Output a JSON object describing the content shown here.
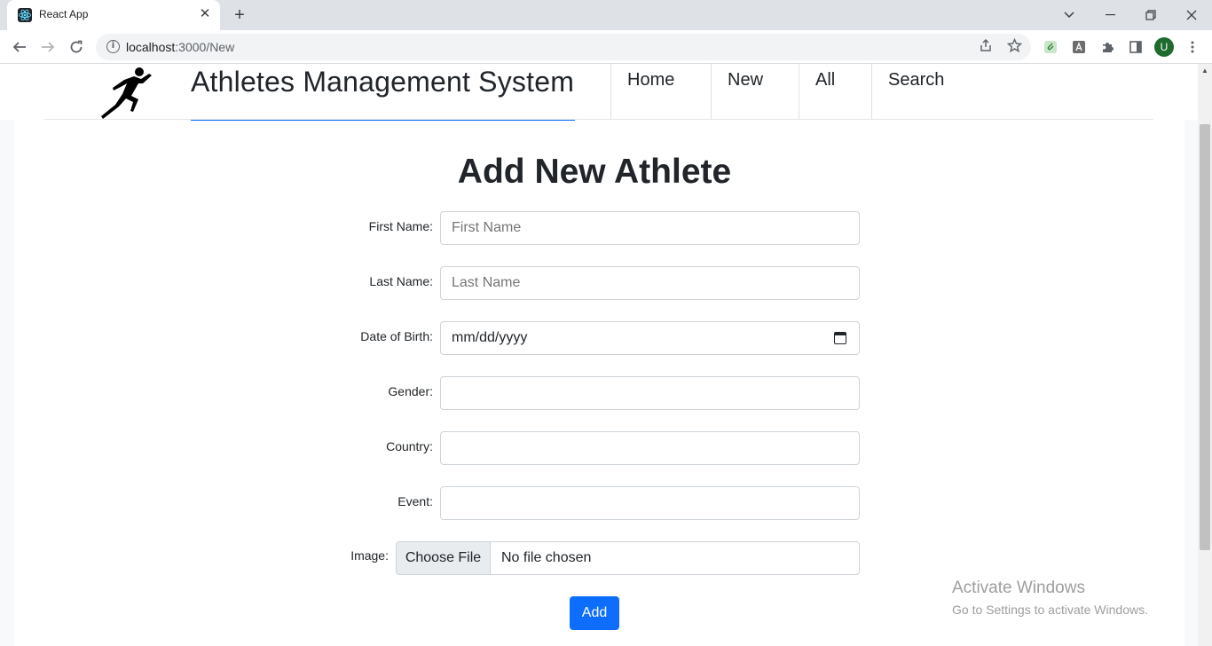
{
  "browser": {
    "tab_title": "React App",
    "tab_close": "✕",
    "new_tab": "+",
    "url_host": "localhost",
    "url_path": ":3000/New",
    "profile_initial": "U"
  },
  "header": {
    "title": "Athletes Management System",
    "nav": [
      "Home",
      "New",
      "All",
      "Search"
    ]
  },
  "form": {
    "heading": "Add New Athlete",
    "fields": [
      {
        "label": "First Name:",
        "placeholder": "First Name"
      },
      {
        "label": "Last Name:",
        "placeholder": "Last Name"
      },
      {
        "label": "Date of Birth:",
        "value": "mm/dd/yyyy"
      },
      {
        "label": "Gender:",
        "value": ""
      },
      {
        "label": "Country:",
        "value": ""
      },
      {
        "label": "Event:",
        "value": ""
      },
      {
        "label": "Image:",
        "button": "Choose File",
        "status": "No file chosen"
      }
    ],
    "submit_label": "Add"
  },
  "watermark": {
    "title": "Activate Windows",
    "subtitle": "Go to Settings to activate Windows."
  },
  "colors": {
    "accent": "#0d6efd",
    "profile": "#1e6b2e"
  }
}
